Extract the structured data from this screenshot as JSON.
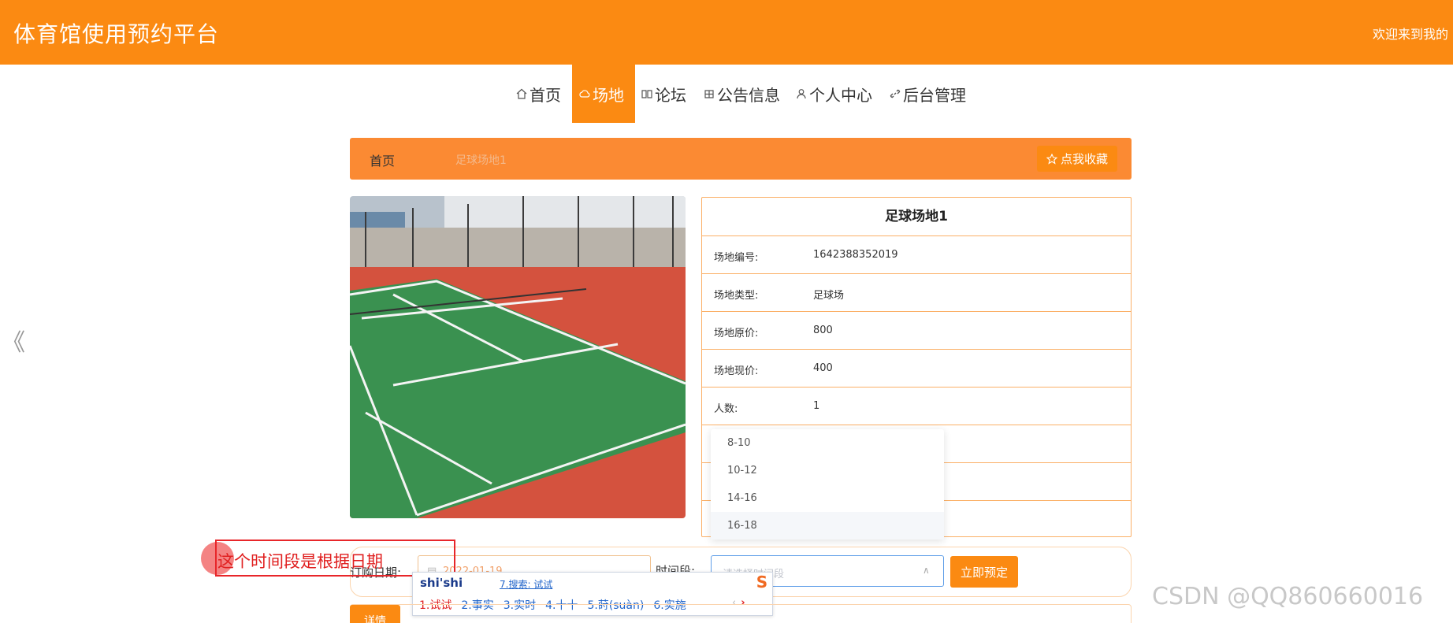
{
  "header": {
    "site_title": "体育馆使用预约平台",
    "welcome_text": "欢迎来到我的"
  },
  "nav": {
    "items": [
      {
        "label": "首页",
        "icon": "home-icon",
        "active": false
      },
      {
        "label": "场地",
        "icon": "cloud-icon",
        "active": true
      },
      {
        "label": "论坛",
        "icon": "book-icon",
        "active": false
      },
      {
        "label": "公告信息",
        "icon": "grid-icon",
        "active": false
      },
      {
        "label": "个人中心",
        "icon": "user-icon",
        "active": false
      },
      {
        "label": "后台管理",
        "icon": "link-icon",
        "active": false
      }
    ]
  },
  "side_arrow": "《",
  "breadcrumb": {
    "home": "首页",
    "current": "足球场地1",
    "favorite_button": "点我收藏",
    "favorite_icon": "star-icon"
  },
  "venue": {
    "title": "足球场地1",
    "rows": [
      {
        "label": "场地编号:",
        "value": "1642388352019"
      },
      {
        "label": "场地类型:",
        "value": "足球场"
      },
      {
        "label": "场地原价:",
        "value": "800"
      },
      {
        "label": "场地现价:",
        "value": "400"
      },
      {
        "label": "人数:",
        "value": "1"
      }
    ]
  },
  "time_dropdown": {
    "options": [
      "8-10",
      "10-12",
      "14-16",
      "16-18"
    ],
    "hovered_index": 3
  },
  "booking": {
    "date_label": "订购日期:",
    "date_value": "2022-01-19",
    "time_label": "时间段:",
    "time_placeholder": "请选择时间段",
    "submit_label": "立即预定"
  },
  "annotation": {
    "text": "这个时间段是根据日期"
  },
  "ime": {
    "pinyin": "shi'shi",
    "search_hint": "7.搜索: 试试",
    "candidates": [
      "1.试试",
      "2.事实",
      "3.实时",
      "4.十十",
      "5.莳(suàn)",
      "6.实施"
    ],
    "logo": "S"
  },
  "detail_tab": "详情",
  "watermark": "CSDN @QQ860660016",
  "colors": {
    "primary": "#fb8a12",
    "breadcrumb_bg": "#fb8a33",
    "border": "#fbb067",
    "annotation": "#e8262a"
  }
}
